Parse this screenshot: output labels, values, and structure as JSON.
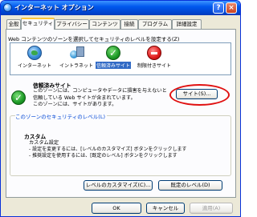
{
  "window": {
    "title": "インターネット オプション"
  },
  "tabs": [
    {
      "label": "全般"
    },
    {
      "label": "セキュリティ"
    },
    {
      "label": "プライバシー"
    },
    {
      "label": "コンテンツ"
    },
    {
      "label": "接続"
    },
    {
      "label": "プログラム"
    },
    {
      "label": "詳細設定"
    }
  ],
  "zones": {
    "description": "Web コンテンツのゾーンを選択してセキュリティのレベルを設定する(Z)",
    "items": [
      {
        "label": "インターネット",
        "icon": "globe-icon"
      },
      {
        "label": "イントラネット",
        "icon": "intranet-icon"
      },
      {
        "label": "信頼済みサイト",
        "icon": "check-icon"
      },
      {
        "label": "制限付きサイト",
        "icon": "stop-icon"
      }
    ]
  },
  "trusted": {
    "title": "信頼済みサイト",
    "desc_lines": [
      "このゾーンには、コンピュータやデータに損害を与えないと",
      "信頼している Web サイトが含まれています。",
      "このゾーンには、サイトがあります。"
    ],
    "sites_button": "サイト(S)..."
  },
  "security": {
    "legend": "このゾーンのセキュリティのレベル(L)",
    "level_title": "カスタム",
    "level_sub": "カスタム設定",
    "lines": [
      "- 設定を変更するには、[レベルのカスタマイズ] ボタンをクリックします",
      "- 推奨設定を使用するには、[既定のレベル] ボタンをクリックします"
    ],
    "custom_button": "レベルのカスタマイズ(C)...",
    "default_button": "既定のレベル(D)"
  },
  "footer": {
    "ok": "OK",
    "cancel": "キャンセル",
    "apply": "適用(A)"
  },
  "colors": {
    "highlight_ring": "#e01010",
    "selection": "#316ac5",
    "link_blue": "#0046d5"
  }
}
